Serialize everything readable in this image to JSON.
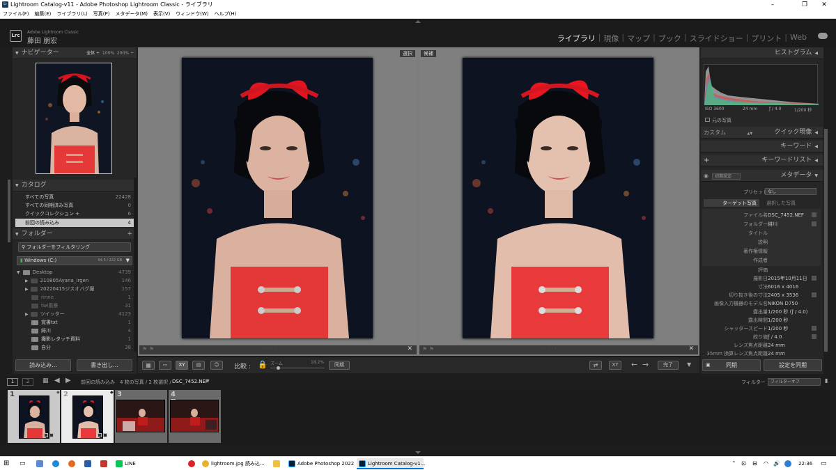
{
  "window": {
    "title": "Lightroom Catalog-v11 - Adobe Photoshop Lightroom Classic - ライブラリ"
  },
  "menu": [
    "ファイル(F)",
    "編集(E)",
    "ライブラリ(L)",
    "写真(P)",
    "メタデータ(M)",
    "表示(V)",
    "ウィンドウ(W)",
    "ヘルプ(H)"
  ],
  "identity": {
    "logo": "Lrc",
    "product": "Adobe Lightroom Classic",
    "user": "藤田 朋宏"
  },
  "modules": [
    "ライブラリ",
    "現像",
    "マップ",
    "ブック",
    "スライドショー",
    "プリント",
    "Web"
  ],
  "navigator": {
    "title": "ナビゲーター",
    "zoom_options": [
      "全体 ÷",
      "100%",
      "200% ÷"
    ]
  },
  "catalog": {
    "title": "カタログ",
    "items": [
      {
        "label": "すべての写真",
        "count": "22428"
      },
      {
        "label": "すべての同期済み写真",
        "count": "0"
      },
      {
        "label": "クイックコレクション +",
        "count": "6"
      },
      {
        "label": "前回の読み込み",
        "count": "4"
      }
    ]
  },
  "folders": {
    "title": "フォルダー",
    "filter_placeholder": "フォルダーをフィルタリング",
    "volume": {
      "name": "Windows (C:)",
      "size": "64.5 / 222 GB"
    },
    "items": [
      {
        "label": "Desktop",
        "count": "4739"
      },
      {
        "label": "210805Ayana_Irgen",
        "count": "146"
      },
      {
        "label": "20220415ジスオバグ撮",
        "count": "157"
      },
      {
        "label": "rinne",
        "count": "1"
      },
      {
        "label": "twi風景",
        "count": "31"
      },
      {
        "label": "ツイッター",
        "count": "4123"
      },
      {
        "label": "覚書txt",
        "count": "1"
      },
      {
        "label": "緋川",
        "count": "4"
      },
      {
        "label": "撮影レタッチ資料",
        "count": "1"
      },
      {
        "label": "自分",
        "count": "38"
      }
    ]
  },
  "left_buttons": {
    "import": "読み込み...",
    "export": "書き出し..."
  },
  "compare": {
    "select_tag": "選択",
    "candidate_tag": "候補"
  },
  "toolbar": {
    "compare_label": "比較 :",
    "zoom_label": "ズーム",
    "zoom_value": "18.2%",
    "sync_label": "同期",
    "done_label": "完了"
  },
  "histogram": {
    "title": "ヒストグラム",
    "iso": "ISO 3600",
    "focal": "24 mm",
    "aperture": "ƒ / 4.0",
    "shutter": "1/200 秒",
    "original_label": "元の写真"
  },
  "quick_develop": {
    "title": "クイック現像",
    "preset": "カスタム"
  },
  "keyword": {
    "title": "キーワード"
  },
  "keyword_list": {
    "title": "キーワードリスト",
    "plus": "+"
  },
  "metadata": {
    "title": "メタデータ",
    "preset_select": "初期設定",
    "preset_label": "プリセット",
    "preset_value": "なし",
    "target_label": "ターゲット写真",
    "selected_label": "選択した写真",
    "rows": [
      {
        "k": "ファイル名",
        "v": "DSC_7452.NEF"
      },
      {
        "k": "フォルダー",
        "v": "緋川"
      },
      {
        "k": "タイトル",
        "v": ""
      },
      {
        "k": "説明",
        "v": ""
      },
      {
        "k": "著作権情報",
        "v": ""
      },
      {
        "k": "作成者",
        "v": ""
      },
      {
        "k": "評価",
        "v": ""
      },
      {
        "k": "撮影日",
        "v": "2015年10月11日"
      },
      {
        "k": "寸法",
        "v": "6016 x 4016"
      },
      {
        "k": "切り抜き後の寸法",
        "v": "2405 x 3536"
      },
      {
        "k": "画像入力機器のモデル名",
        "v": "NIKON D750"
      },
      {
        "k": "露出量",
        "v": "1/200 秒 (ƒ / 4.0)"
      },
      {
        "k": "露出時間",
        "v": "1/200 秒"
      },
      {
        "k": "シャッタースピード",
        "v": "1/200 秒"
      },
      {
        "k": "絞り値",
        "v": "ƒ / 4.0"
      },
      {
        "k": "レンズ焦点距離",
        "v": "24 mm"
      },
      {
        "k": "35mm 換算レンズ焦点距離",
        "v": "24 mm"
      }
    ]
  },
  "right_buttons": {
    "sync": "同期",
    "sync_settings": "設定を同期"
  },
  "filmstrip": {
    "page1": "1",
    "page2": "2",
    "path": "前回の読み込み",
    "info": "4 枚の写真 / 2 枚選択 /",
    "file": "DSC_7452.NEF",
    "filter_label": "フィルター :",
    "filter_value": "フィルターオフ",
    "cells": [
      "1",
      "2",
      "3",
      "4"
    ]
  },
  "taskbar": {
    "line": "LINE",
    "chrome": "lightroom.jpg 読み込...",
    "photoshop": "Adobe Photoshop 2022",
    "lightroom": "Lightroom Catalog-v1...",
    "time": "22:36"
  }
}
